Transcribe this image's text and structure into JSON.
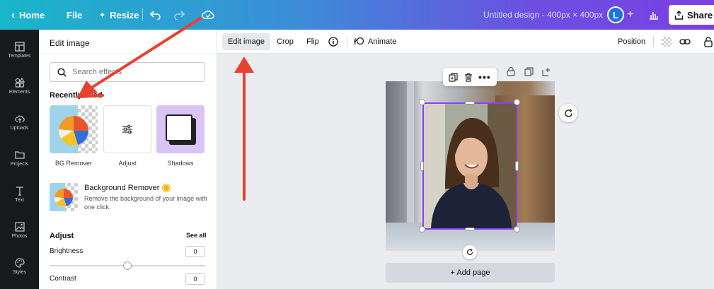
{
  "topbar": {
    "home_label": "Home",
    "file_label": "File",
    "resize_label": "Resize",
    "design_title": "Untitled design - 400px × 400px",
    "avatar_letter": "L",
    "share_label": "Share"
  },
  "rail": {
    "items": [
      {
        "label": "Templates"
      },
      {
        "label": "Elements"
      },
      {
        "label": "Uploads"
      },
      {
        "label": "Projects"
      },
      {
        "label": "Text"
      },
      {
        "label": "Photos"
      },
      {
        "label": "Styles"
      }
    ]
  },
  "panel": {
    "header": "Edit image",
    "search_placeholder": "Search effects",
    "recently_used_title": "Recently used",
    "thumbs": [
      {
        "label": "BG Remover"
      },
      {
        "label": "Adjust"
      },
      {
        "label": "Shadows"
      }
    ],
    "bg_remover": {
      "title": "Background Remover",
      "description": "Remove the background of your image with one click."
    },
    "adjust": {
      "title": "Adjust",
      "see_all": "See all",
      "brightness_label": "Brightness",
      "brightness_value": "0",
      "contrast_label": "Contrast",
      "contrast_value": "0"
    }
  },
  "toolbar": {
    "edit_image": "Edit image",
    "crop": "Crop",
    "flip": "Flip",
    "animate": "Animate",
    "position": "Position"
  },
  "canvas": {
    "add_page_label": "+ Add page"
  },
  "colors": {
    "accent_purple": "#8b3dff",
    "annotation_red": "#e8412f",
    "rail_bg": "#18191b"
  }
}
